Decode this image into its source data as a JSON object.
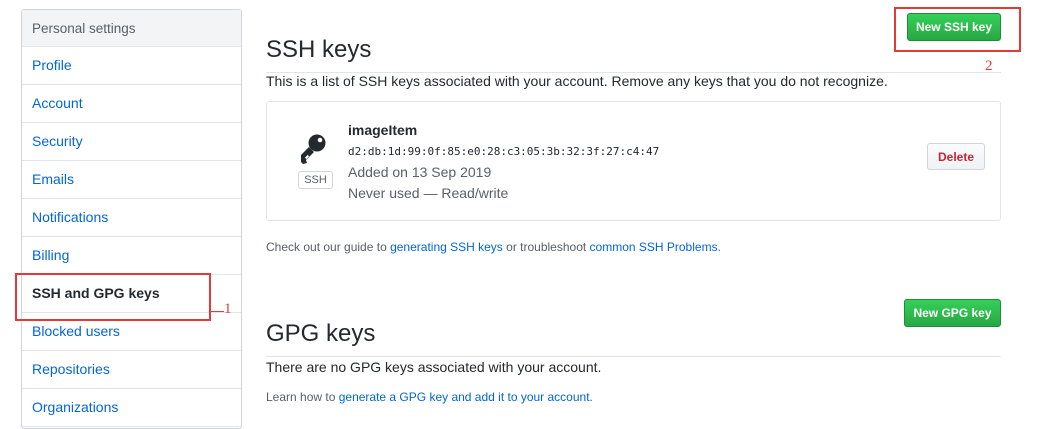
{
  "sidebar": {
    "header": "Personal settings",
    "items": [
      {
        "label": "Profile"
      },
      {
        "label": "Account"
      },
      {
        "label": "Security"
      },
      {
        "label": "Emails"
      },
      {
        "label": "Notifications"
      },
      {
        "label": "Billing"
      },
      {
        "label": "SSH and GPG keys",
        "selected": true
      },
      {
        "label": "Blocked users"
      },
      {
        "label": "Repositories"
      },
      {
        "label": "Organizations"
      }
    ]
  },
  "annotations": {
    "one": "1",
    "two": "2"
  },
  "ssh": {
    "title": "SSH keys",
    "new_button": "New SSH key",
    "intro": "This is a list of SSH keys associated with your account. Remove any keys that you do not recognize.",
    "key": {
      "title": "imageItem",
      "fingerprint": "d2:db:1d:99:0f:85:e0:28:c3:05:3b:32:3f:27:c4:47",
      "added": "Added on 13 Sep 2019",
      "usage": "Never used — Read/write",
      "badge": "SSH",
      "icon": "key-icon",
      "delete_label": "Delete"
    },
    "help": {
      "prefix": "Check out our guide to ",
      "link1": "generating SSH keys",
      "middle": " or troubleshoot ",
      "link2": "common SSH Problems",
      "suffix": "."
    }
  },
  "gpg": {
    "title": "GPG keys",
    "new_button": "New GPG key",
    "empty": "There are no GPG keys associated with your account.",
    "help": {
      "prefix": "Learn how to ",
      "link": "generate a GPG key and add it to your account",
      "suffix": "."
    }
  },
  "colors": {
    "accent": "#0366d6",
    "green": "#28a745",
    "danger": "#cb2431",
    "annotation": "#e03a3a"
  }
}
